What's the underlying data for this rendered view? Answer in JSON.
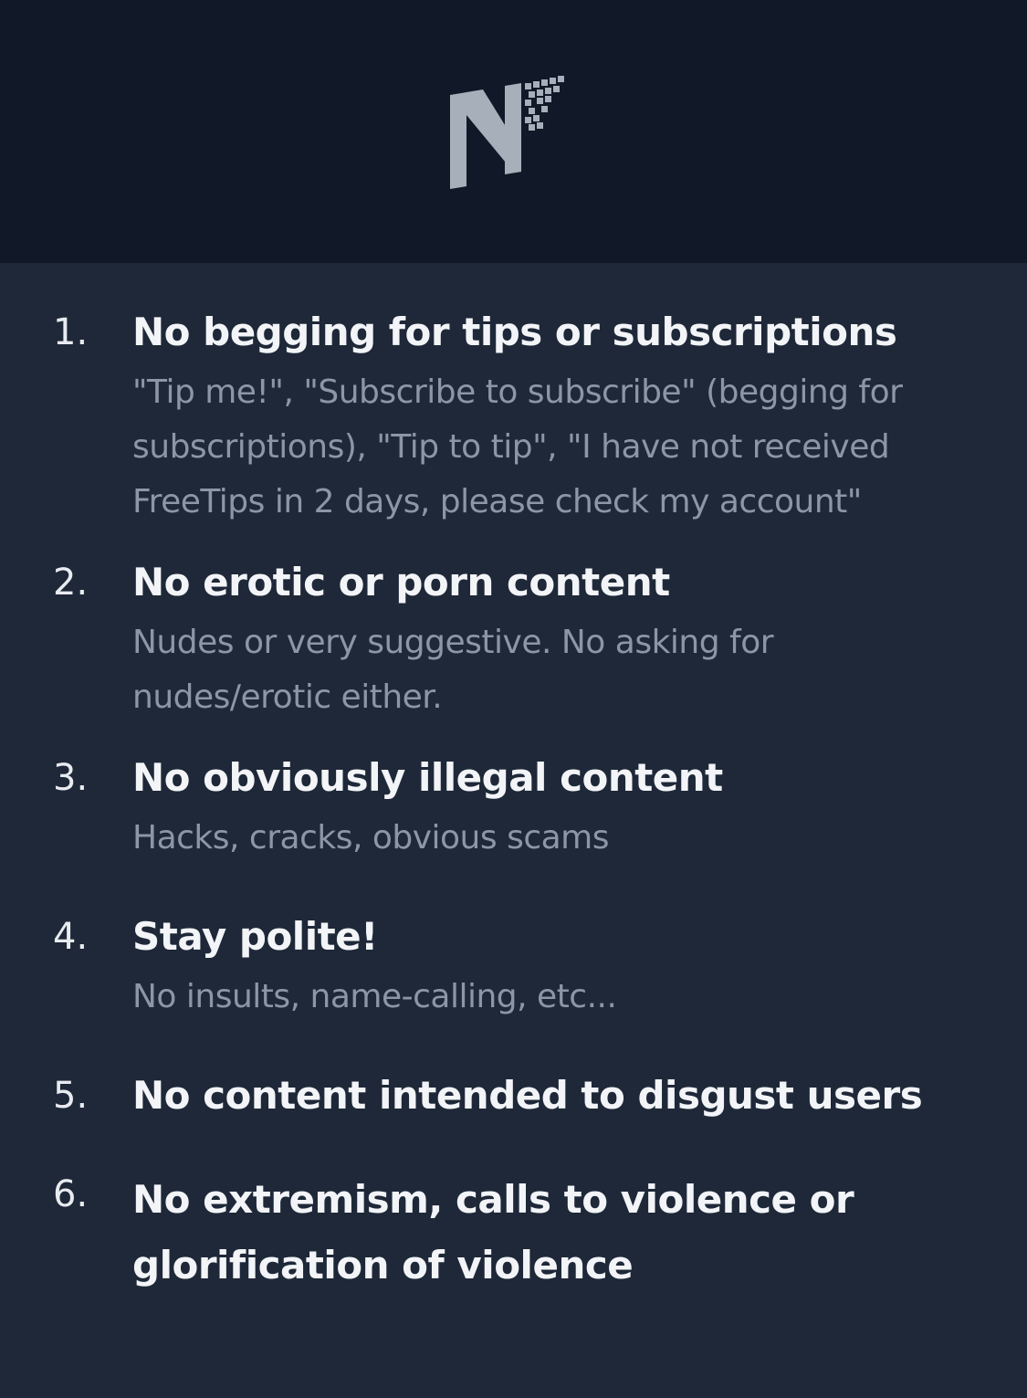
{
  "header": {
    "logo_icon": "netpulse-n-logo-icon",
    "logo_color": "#a7afba"
  },
  "rules": [
    {
      "number": "1.",
      "title": "No begging for tips or subscriptions",
      "description": "\"Tip me!\", \"Subscribe to subscribe\" (begging for subscriptions), \"Tip to tip\", \"I have not received FreeTips in 2 days, please check my account\""
    },
    {
      "number": "2.",
      "title": "No erotic or porn content",
      "description": "Nudes or very suggestive. No asking for nudes/erotic either."
    },
    {
      "number": "3.",
      "title": "No obviously illegal content",
      "description": "Hacks, cracks, obvious scams"
    },
    {
      "number": "4.",
      "title": "Stay polite!",
      "description": "No insults, name-calling, etc..."
    },
    {
      "number": "5.",
      "title": "No content intended to disgust users",
      "description": ""
    },
    {
      "number": "6.",
      "title": "No extremism, calls to violence or glorification of violence",
      "description": ""
    }
  ],
  "colors": {
    "header_bg": "#111928",
    "body_bg": "#1e2838",
    "title_text": "#f2f4f7",
    "description_text": "#8d96a4"
  }
}
